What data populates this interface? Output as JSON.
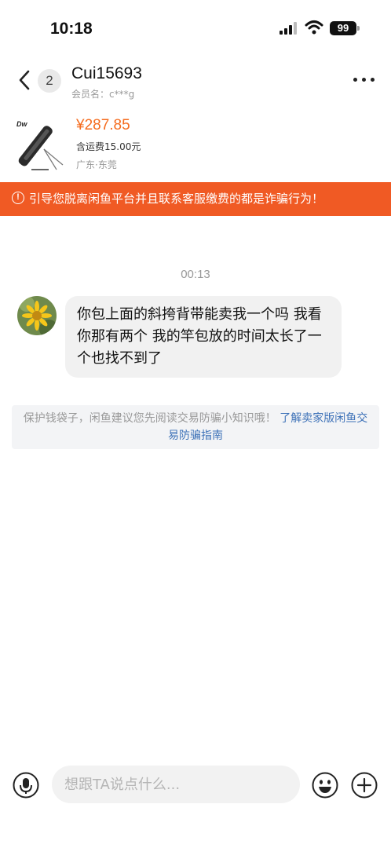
{
  "status_bar": {
    "time": "10:18",
    "battery": "99"
  },
  "header": {
    "unread_count": "2",
    "nickname": "Cui15693",
    "member_label": "会员名：c***g"
  },
  "product": {
    "price": "¥287.85",
    "shipping": "含运费15.00元",
    "location": "广东·东莞",
    "brand_text": "Dw"
  },
  "warning": {
    "text": "引导您脱离闲鱼平台并且联系客服缴费的都是诈骗行为！"
  },
  "chat": {
    "timestamp": "00:13",
    "message": "你包上面的斜挎背带能卖我一个吗 我看你那有两个 我的竿包放的时间太长了一个也找不到了",
    "tip_text": "保护钱袋子，闲鱼建议您先阅读交易防骗小知识哦！",
    "tip_link": "了解卖家版闲鱼交易防骗指南"
  },
  "input": {
    "placeholder": "想跟TA说点什么..."
  },
  "colors": {
    "accent": "#f56b1d",
    "warning_bg": "#f05a24",
    "link": "#3e72b8"
  }
}
